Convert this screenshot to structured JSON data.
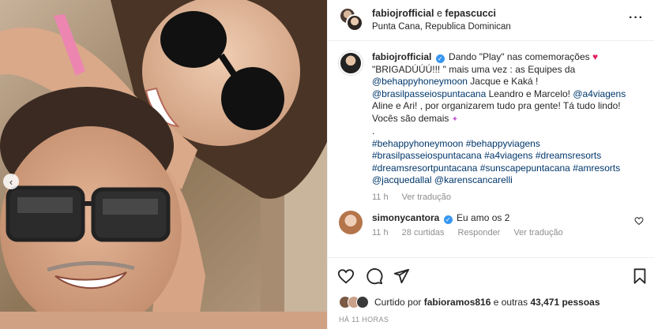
{
  "header": {
    "user1": "fabiojrofficial",
    "connector": "e",
    "user2": "fepascucci",
    "location": "Punta Cana, Republica Dominican",
    "more": "···"
  },
  "caption": {
    "username": "fabiojrofficial",
    "line1": "Dando \"Play\" nas comemorações",
    "line2": "\"BRIGADÚÚÚ!!! \" mais uma vez : as Equipes da",
    "mention1": "@behappyhoneymoon",
    "text_a": " Jacque e Kaká !",
    "mention2": "@brasilpasseiospuntacana",
    "text_b": " Leandro e Marcelo! ",
    "mention3": "@a4viagens",
    "text_c": " Aline e Ari! , por organizarem tudo pra gente! Tá tudo lindo! Vocês são demais",
    "dot": ".",
    "tags_line1": [
      "#behappyhoneymoon",
      "#behappyviagens"
    ],
    "tags_line2": [
      "#brasilpasseiospuntacana",
      "#a4viagens",
      "#dreamsresorts"
    ],
    "tags_line3": [
      "#dreamsresortpuntacana",
      "#sunscapepuntacana",
      "#amresorts"
    ],
    "tags_line4": [
      "@jacquedallal",
      "@karenscancarelli"
    ],
    "age": "11 h",
    "see_translation": "Ver tradução"
  },
  "comment": {
    "username": "simonycantora",
    "text": "Eu amo os 2",
    "age": "11 h",
    "likes": "28 curtidas",
    "reply": "Responder",
    "see_translation": "Ver tradução"
  },
  "likes": {
    "prefix": "Curtido por ",
    "user": "fabioramos816",
    "suffix": " e outras ",
    "count": "43,471",
    "suffix2": " pessoas"
  },
  "timestamp": "HÁ 11 HORAS",
  "icons": [
    "heart-icon",
    "comment-icon",
    "share-icon",
    "bookmark-icon",
    "verified-icon",
    "chevron-left-icon",
    "more-icon"
  ],
  "colors": {
    "link": "#00376b",
    "meta": "#8e8e8e",
    "verified": "#3897f0"
  }
}
